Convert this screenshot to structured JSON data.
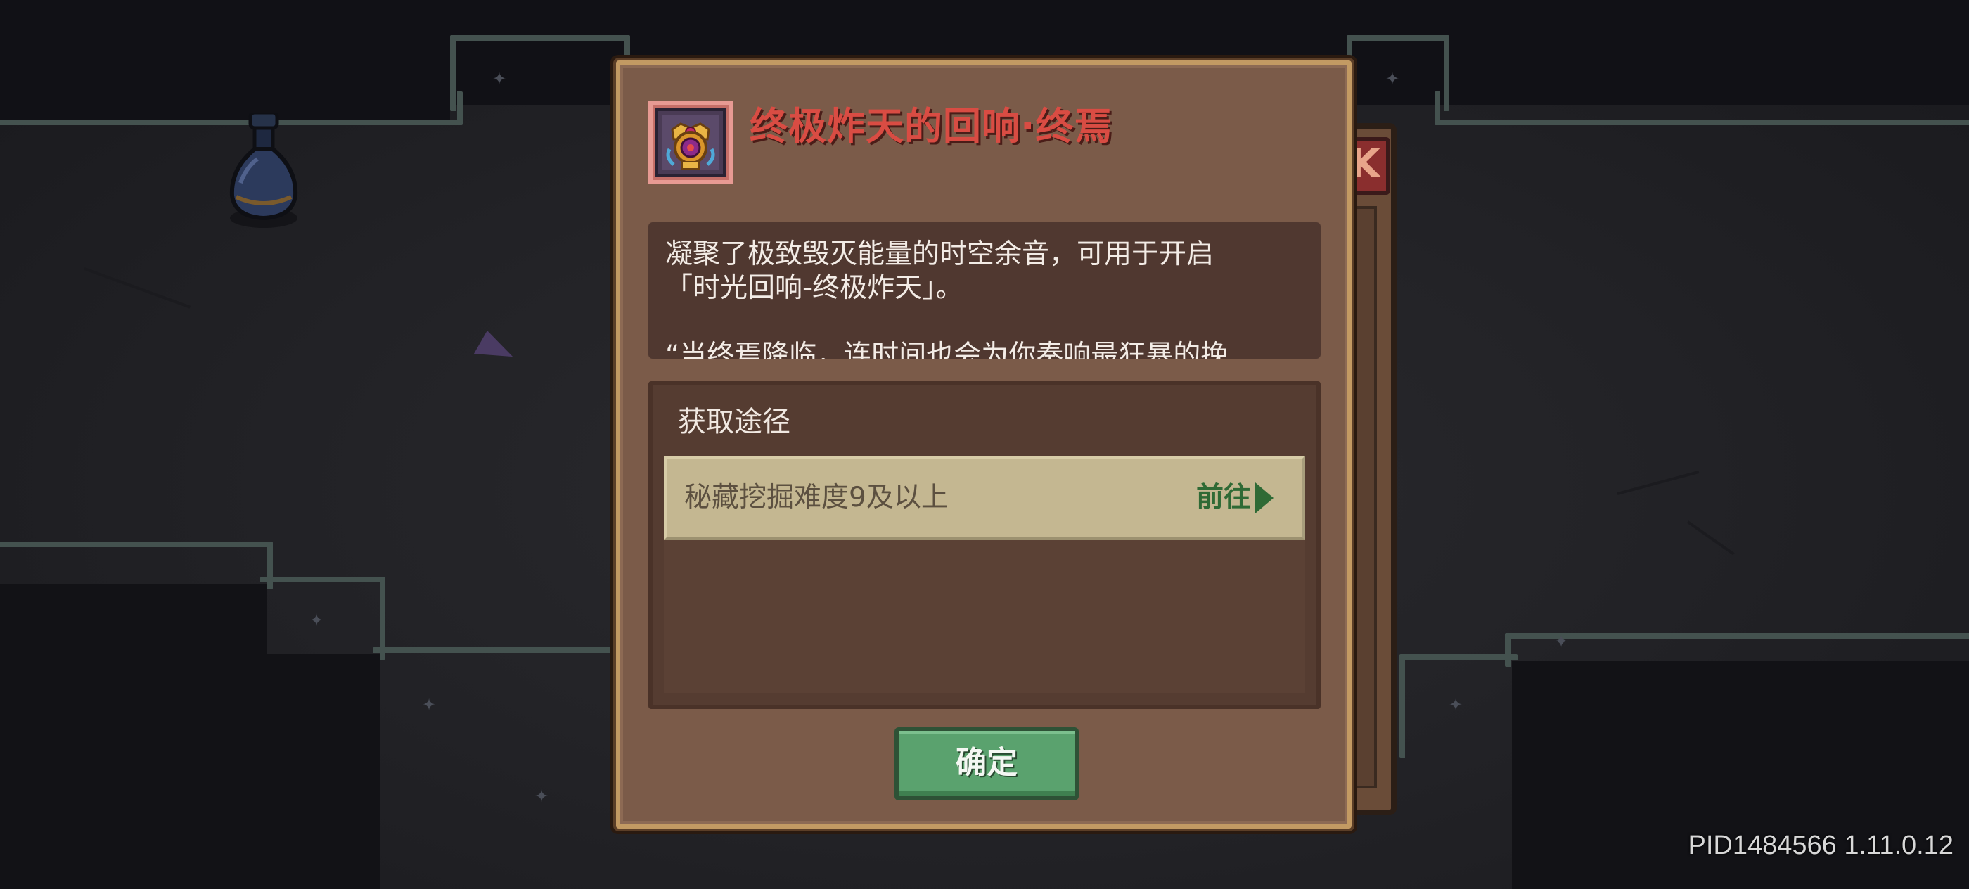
{
  "item": {
    "title": "终极炸天的回响·终焉",
    "icon": "crowned-emblem-icon",
    "title_color": "#d94c43"
  },
  "description": "凝聚了极致毁灭能量的时空余音，可用于开启\n「时光回响-终极炸天」。\n\n“当终焉降临，连时间也会为你奏响最狂暴的挽",
  "sources": {
    "heading": "获取途径",
    "items": [
      {
        "label": "秘藏挖掘难度9及以上",
        "action": "前往"
      }
    ]
  },
  "confirm_label": "确定",
  "background": {
    "close_glyph": "K"
  },
  "version": "PID1484566 1.11.0.12",
  "colors": {
    "dialog_bg": "#7b5b49",
    "dialog_border": "#c39a63",
    "confirm_bg": "#5aa26e",
    "goto_green": "#2f6a35"
  }
}
